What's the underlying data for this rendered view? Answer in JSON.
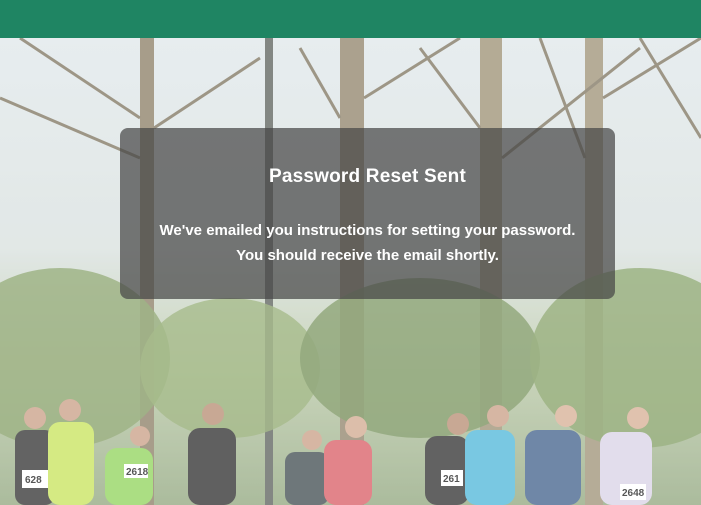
{
  "header": {
    "bar_color": "#1f8563"
  },
  "hero": {
    "image_description_icon": "runners-photo-icon"
  },
  "notice": {
    "title": "Password Reset Sent",
    "line1": "We've emailed you instructions for setting your password.",
    "line2": "You should receive the email shortly."
  },
  "bibs": [
    "628",
    "2618",
    "261",
    "2648"
  ]
}
